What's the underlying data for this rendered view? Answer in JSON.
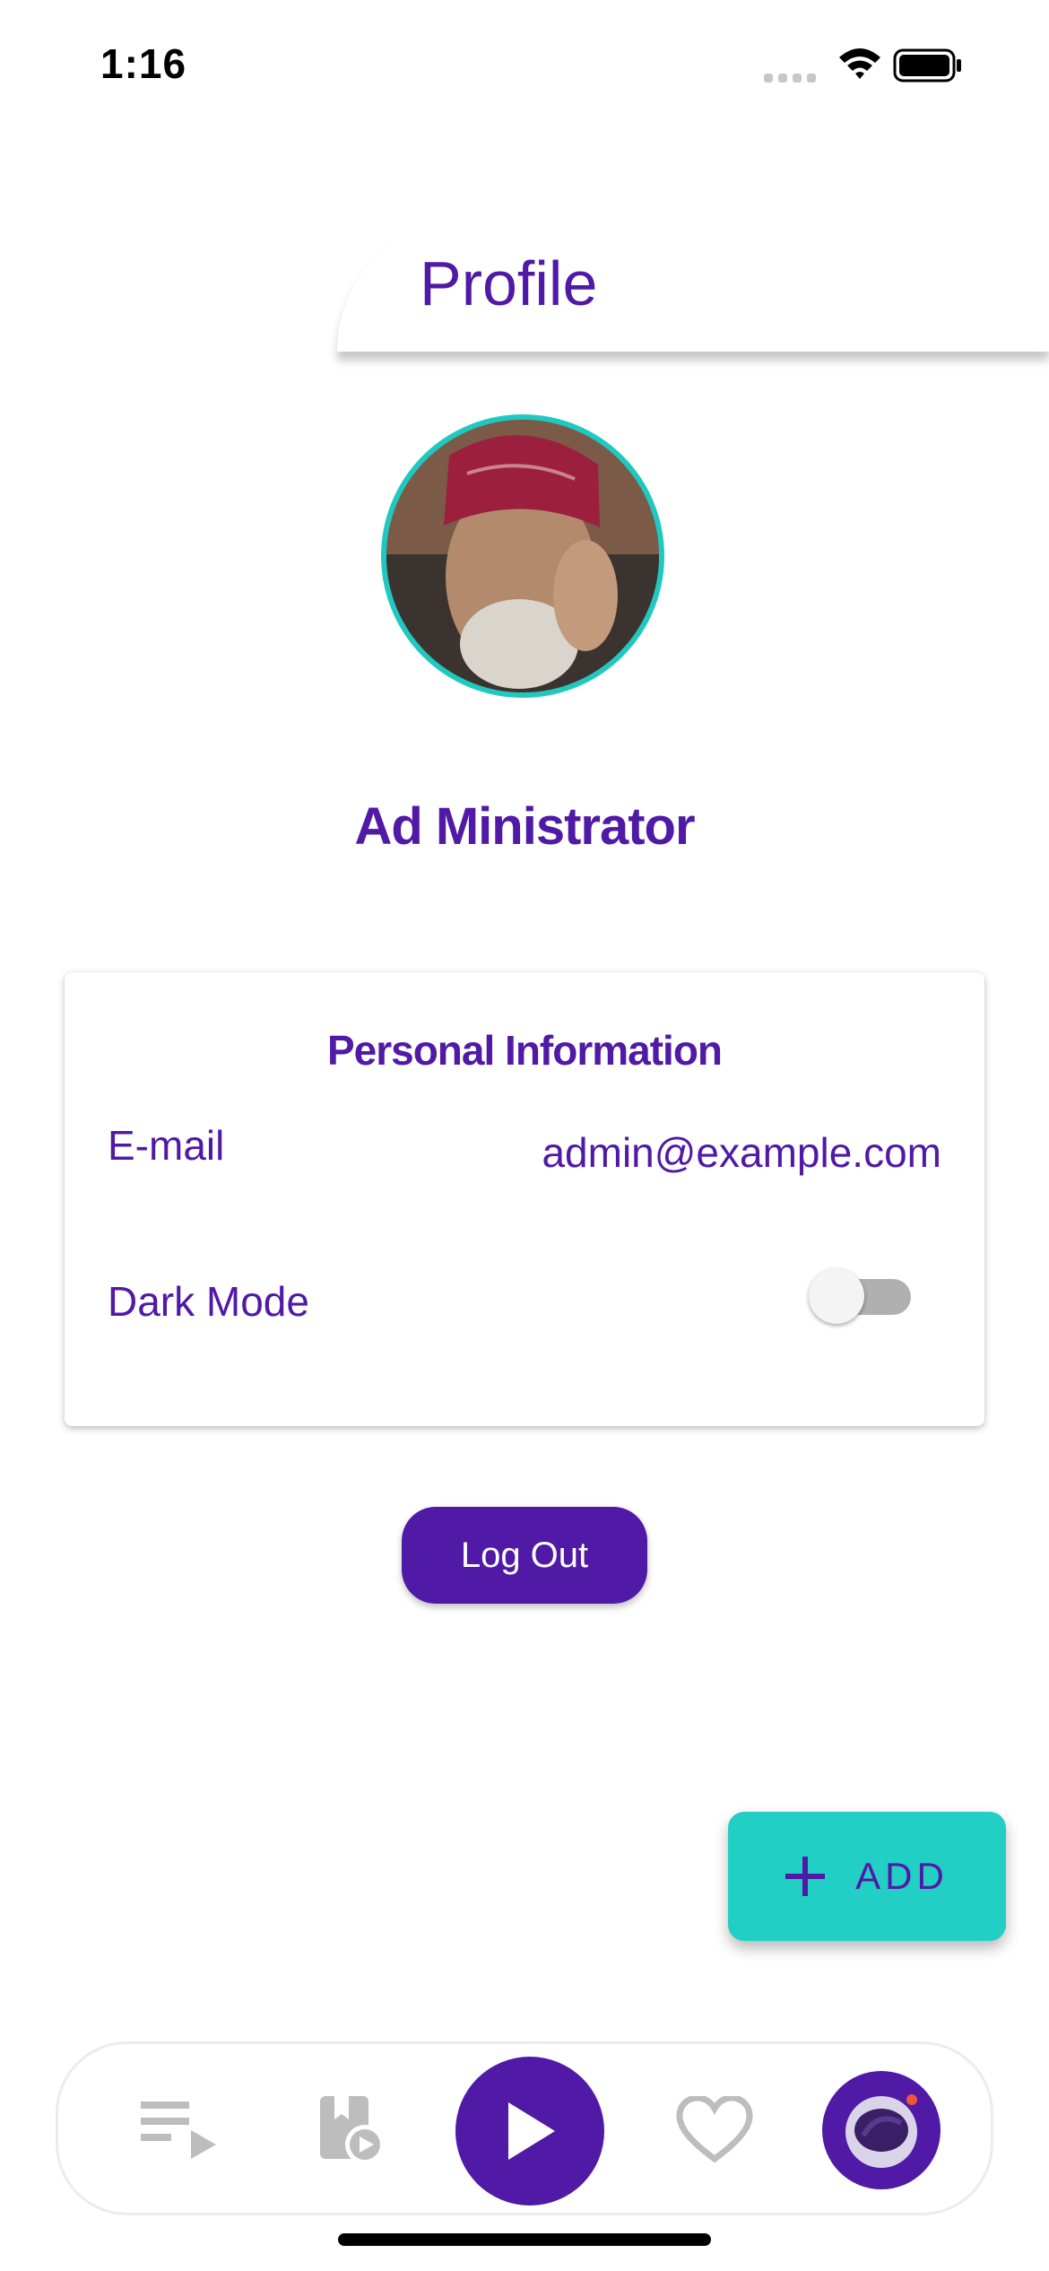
{
  "status_bar": {
    "time": "1:16"
  },
  "header": {
    "title": "Profile"
  },
  "profile": {
    "name": "Ad Ministrator"
  },
  "personal_info": {
    "title": "Personal Information",
    "email_label": "E-mail",
    "email_value": "admin@example.com",
    "dark_mode_label": "Dark Mode",
    "dark_mode_enabled": false
  },
  "actions": {
    "logout_label": "Log Out",
    "add_label": "ADD"
  },
  "bottom_nav": {
    "items": [
      {
        "icon": "queue-icon"
      },
      {
        "icon": "media-library-icon"
      },
      {
        "icon": "play-icon"
      },
      {
        "icon": "heart-icon"
      },
      {
        "icon": "astronaut-icon"
      }
    ]
  },
  "colors": {
    "primary": "#5019a6",
    "accent": "#20c9c0",
    "fab": "#22cfc5"
  }
}
